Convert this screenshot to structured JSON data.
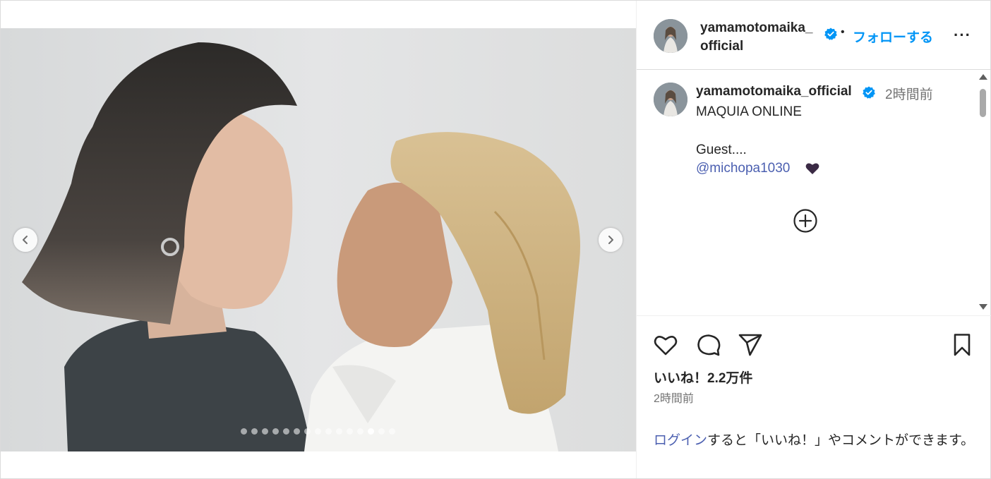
{
  "post": {
    "media": {
      "total_images": 15,
      "active_index": 12,
      "prev_icon": "chevron-left-icon",
      "next_icon": "chevron-right-icon"
    },
    "header": {
      "username": "yamamotomaika_official",
      "username_line1": "yamamotomaika_",
      "username_line2": "official",
      "verified_icon": "verified-badge-icon",
      "separator": "•",
      "follow_label": "フォローする",
      "more_label": "···"
    },
    "caption": {
      "username": "yamamotomaika_official",
      "time": "2時間前",
      "line1": "MAQUIA ONLINE",
      "line2": "Guest....",
      "mention": "@michopa1030",
      "emoji_icon": "black-heart-icon",
      "expand_icon": "plus-circle-icon"
    },
    "actions": {
      "like_icon": "heart-icon",
      "comment_icon": "comment-icon",
      "share_icon": "send-icon",
      "save_icon": "bookmark-icon",
      "likes_text": "いいね！2.2万件",
      "time": "2時間前",
      "login_link": "ログイン",
      "login_rest": "すると「いいね！」やコメントができます。"
    }
  },
  "colors": {
    "accent": "#0095f6",
    "link": "#4b5fb0",
    "text": "#262626",
    "muted": "#737373",
    "border": "#dbdbdb"
  }
}
